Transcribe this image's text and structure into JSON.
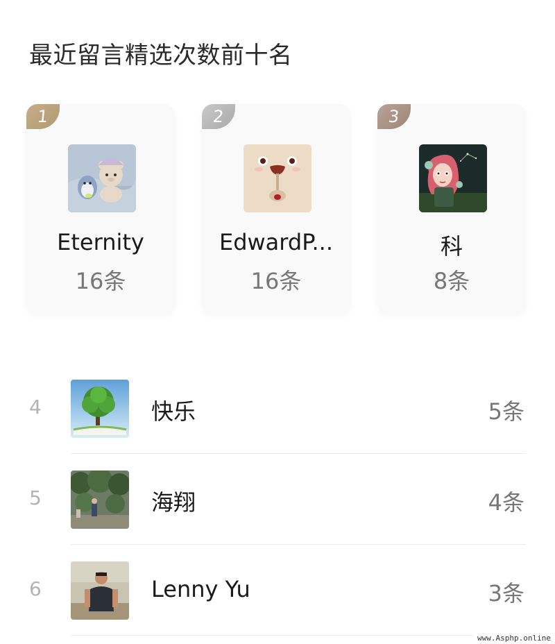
{
  "header": {
    "title": "最近留言精选次数前十名"
  },
  "top3": [
    {
      "rank": "1",
      "name": "Eternity",
      "count": "16条",
      "badge": "gold",
      "avatar_icon": "plush-bear-icon"
    },
    {
      "rank": "2",
      "name": "EdwardP...",
      "count": "16条",
      "badge": "silver",
      "avatar_icon": "cartoon-bear-face-icon"
    },
    {
      "rank": "3",
      "name": "科",
      "count": "8条",
      "badge": "bronze",
      "avatar_icon": "illustrated-girl-icon"
    }
  ],
  "list": [
    {
      "rank": "4",
      "name": "快乐",
      "count": "5条",
      "avatar_icon": "tree-book-icon"
    },
    {
      "rank": "5",
      "name": "海翔",
      "count": "4条",
      "avatar_icon": "garden-photo-icon"
    },
    {
      "rank": "6",
      "name": "Lenny Yu",
      "count": "3条",
      "avatar_icon": "person-photo-icon"
    }
  ],
  "watermark": "www.Asphp.online",
  "colors": {
    "gold": "#b9a37d",
    "silver": "#b4b4b4",
    "bronze": "#a88f81",
    "muted_text": "#777777",
    "rank_text": "#b3b3b3"
  }
}
